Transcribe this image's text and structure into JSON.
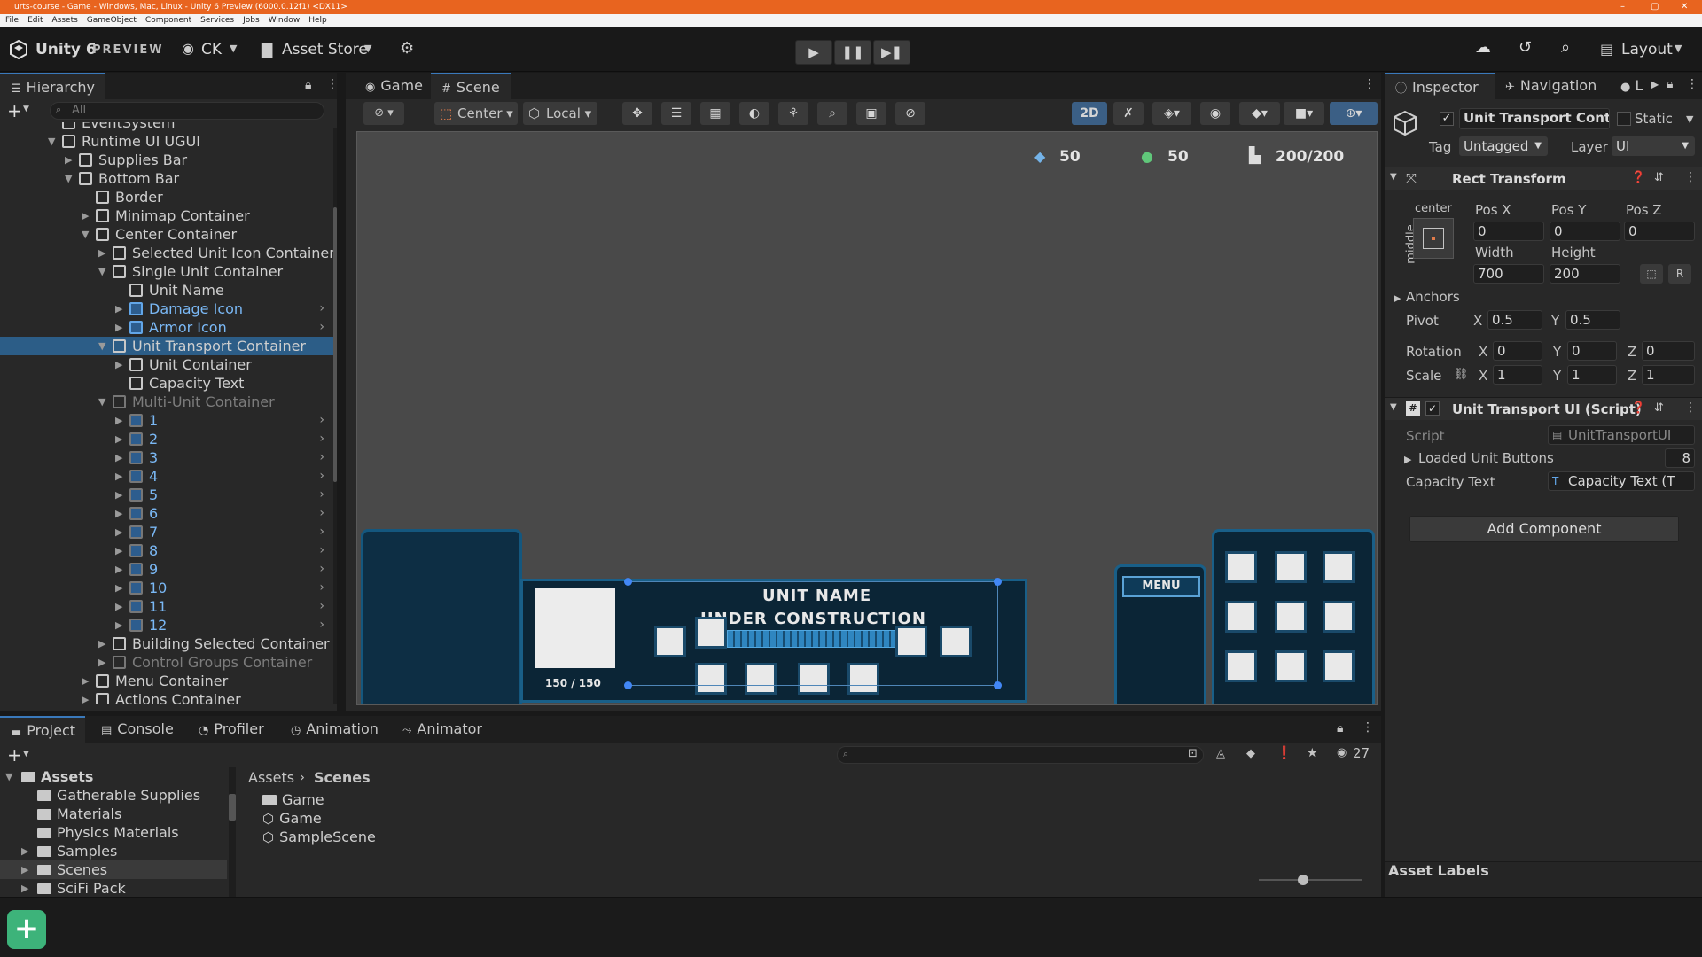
{
  "window": {
    "title": "urts-course - Game - Windows, Mac, Linux - Unity 6 Preview (6000.0.12f1) <DX11>",
    "controls": [
      "–",
      "▢",
      "✕"
    ]
  },
  "menubar": [
    "File",
    "Edit",
    "Assets",
    "GameObject",
    "Component",
    "Services",
    "Jobs",
    "Window",
    "Help"
  ],
  "toolbar": {
    "app_name": "Unity 6",
    "app_suffix": "PREVIEW",
    "account": "CK",
    "asset_store": "Asset Store",
    "layout": "Layout"
  },
  "hierarchy": {
    "tab": "Hierarchy",
    "search_placeholder": "All",
    "rows": [
      {
        "label": "EventSystem",
        "indent": 0,
        "arrow": "",
        "style": "normal"
      },
      {
        "label": "Runtime UI UGUI",
        "indent": 0,
        "arrow": "▼",
        "style": "normal"
      },
      {
        "label": "Supplies Bar",
        "indent": 1,
        "arrow": "▶",
        "style": "normal"
      },
      {
        "label": "Bottom Bar",
        "indent": 1,
        "arrow": "▼",
        "style": "normal"
      },
      {
        "label": "Border",
        "indent": 2,
        "arrow": "",
        "style": "normal"
      },
      {
        "label": "Minimap Container",
        "indent": 2,
        "arrow": "▶",
        "style": "normal"
      },
      {
        "label": "Center Container",
        "indent": 2,
        "arrow": "▼",
        "style": "normal"
      },
      {
        "label": "Selected Unit Icon Container",
        "indent": 3,
        "arrow": "▶",
        "style": "normal"
      },
      {
        "label": "Single Unit Container",
        "indent": 3,
        "arrow": "▼",
        "style": "normal"
      },
      {
        "label": "Unit Name",
        "indent": 4,
        "arrow": "",
        "style": "normal"
      },
      {
        "label": "Damage Icon",
        "indent": 4,
        "arrow": "▶",
        "style": "blue"
      },
      {
        "label": "Armor Icon",
        "indent": 4,
        "arrow": "▶",
        "style": "blue"
      },
      {
        "label": "Unit Transport Container",
        "indent": 3,
        "arrow": "▼",
        "style": "sel"
      },
      {
        "label": "Unit Container",
        "indent": 4,
        "arrow": "▶",
        "style": "normal"
      },
      {
        "label": "Capacity Text",
        "indent": 4,
        "arrow": "",
        "style": "normal"
      },
      {
        "label": "Multi-Unit Container",
        "indent": 3,
        "arrow": "▼",
        "style": "dim"
      },
      {
        "label": "1",
        "indent": 4,
        "arrow": "▶",
        "style": "dimblue"
      },
      {
        "label": "2",
        "indent": 4,
        "arrow": "▶",
        "style": "dimblue"
      },
      {
        "label": "3",
        "indent": 4,
        "arrow": "▶",
        "style": "dimblue"
      },
      {
        "label": "4",
        "indent": 4,
        "arrow": "▶",
        "style": "dimblue"
      },
      {
        "label": "5",
        "indent": 4,
        "arrow": "▶",
        "style": "dimblue"
      },
      {
        "label": "6",
        "indent": 4,
        "arrow": "▶",
        "style": "dimblue"
      },
      {
        "label": "7",
        "indent": 4,
        "arrow": "▶",
        "style": "dimblue"
      },
      {
        "label": "8",
        "indent": 4,
        "arrow": "▶",
        "style": "dimblue"
      },
      {
        "label": "9",
        "indent": 4,
        "arrow": "▶",
        "style": "dimblue"
      },
      {
        "label": "10",
        "indent": 4,
        "arrow": "▶",
        "style": "dimblue"
      },
      {
        "label": "11",
        "indent": 4,
        "arrow": "▶",
        "style": "dimblue"
      },
      {
        "label": "12",
        "indent": 4,
        "arrow": "▶",
        "style": "dimblue"
      },
      {
        "label": "Building Selected Container",
        "indent": 3,
        "arrow": "▶",
        "style": "normal"
      },
      {
        "label": "Control Groups Container",
        "indent": 3,
        "arrow": "▶",
        "style": "dim"
      },
      {
        "label": "Menu Container",
        "indent": 2,
        "arrow": "▶",
        "style": "normal"
      },
      {
        "label": "Actions Container",
        "indent": 2,
        "arrow": "▶",
        "style": "normal"
      }
    ]
  },
  "scene": {
    "tabs": [
      "Game",
      "Scene"
    ],
    "pivot": "Center",
    "space": "Local",
    "mode_2d": "2D",
    "hud": {
      "crystals": "50",
      "gas": "50",
      "supply": "200/200"
    },
    "bottom_bar": {
      "unit_name": "UNIT NAME",
      "status": "UNDER CONSTRUCTION",
      "health": "150 / 150",
      "menu": "MENU"
    }
  },
  "inspector": {
    "tabs": [
      "Inspector",
      "Navigation",
      "L"
    ],
    "object_name": "Unit Transport Conta",
    "static_label": "Static",
    "tag_label": "Tag",
    "tag_value": "Untagged",
    "layer_label": "Layer",
    "layer_value": "UI",
    "rect_transform": {
      "title": "Rect Transform",
      "anchor_h": "center",
      "anchor_v": "middle",
      "pos_x_label": "Pos X",
      "pos_y_label": "Pos Y",
      "pos_z_label": "Pos Z",
      "pos_x": "0",
      "pos_y": "0",
      "pos_z": "0",
      "width_label": "Width",
      "height_label": "Height",
      "width": "700",
      "height": "200",
      "anchors_label": "Anchors",
      "pivot_label": "Pivot",
      "pivot_x": "0.5",
      "pivot_y": "0.5",
      "rotation_label": "Rotation",
      "rot_x": "0",
      "rot_y": "0",
      "rot_z": "0",
      "scale_label": "Scale",
      "scale_x": "1",
      "scale_y": "1",
      "scale_z": "1",
      "x": "X",
      "y": "Y",
      "z": "Z"
    },
    "script_component": {
      "title": "Unit Transport UI (Script)",
      "script_label": "Script",
      "script_value": "UnitTransportUI",
      "loaded_label": "Loaded Unit Buttons",
      "loaded_value": "8",
      "capacity_label": "Capacity Text",
      "capacity_value": "Capacity Text (T"
    },
    "add_component": "Add Component",
    "asset_labels": "Asset Labels",
    "r_button": "R"
  },
  "bottom": {
    "tabs": [
      "Project",
      "Console",
      "Profiler",
      "Animation",
      "Animator"
    ],
    "hidden_count": "27",
    "folders": [
      {
        "label": "Assets",
        "indent": 0,
        "arrow": "▼",
        "bold": true
      },
      {
        "label": "Gatherable Supplies",
        "indent": 1,
        "arrow": "",
        "bold": false
      },
      {
        "label": "Materials",
        "indent": 1,
        "arrow": "",
        "bold": false
      },
      {
        "label": "Physics Materials",
        "indent": 1,
        "arrow": "",
        "bold": false
      },
      {
        "label": "Samples",
        "indent": 1,
        "arrow": "▶",
        "bold": false
      },
      {
        "label": "Scenes",
        "indent": 1,
        "arrow": "▶",
        "bold": false
      },
      {
        "label": "SciFi Pack",
        "indent": 1,
        "arrow": "▶",
        "bold": false
      }
    ],
    "breadcrumb": [
      "Assets",
      "Scenes"
    ],
    "files": [
      {
        "label": "Game",
        "kind": "folder"
      },
      {
        "label": "Game",
        "kind": "scene"
      },
      {
        "label": "SampleScene",
        "kind": "scene"
      }
    ]
  }
}
